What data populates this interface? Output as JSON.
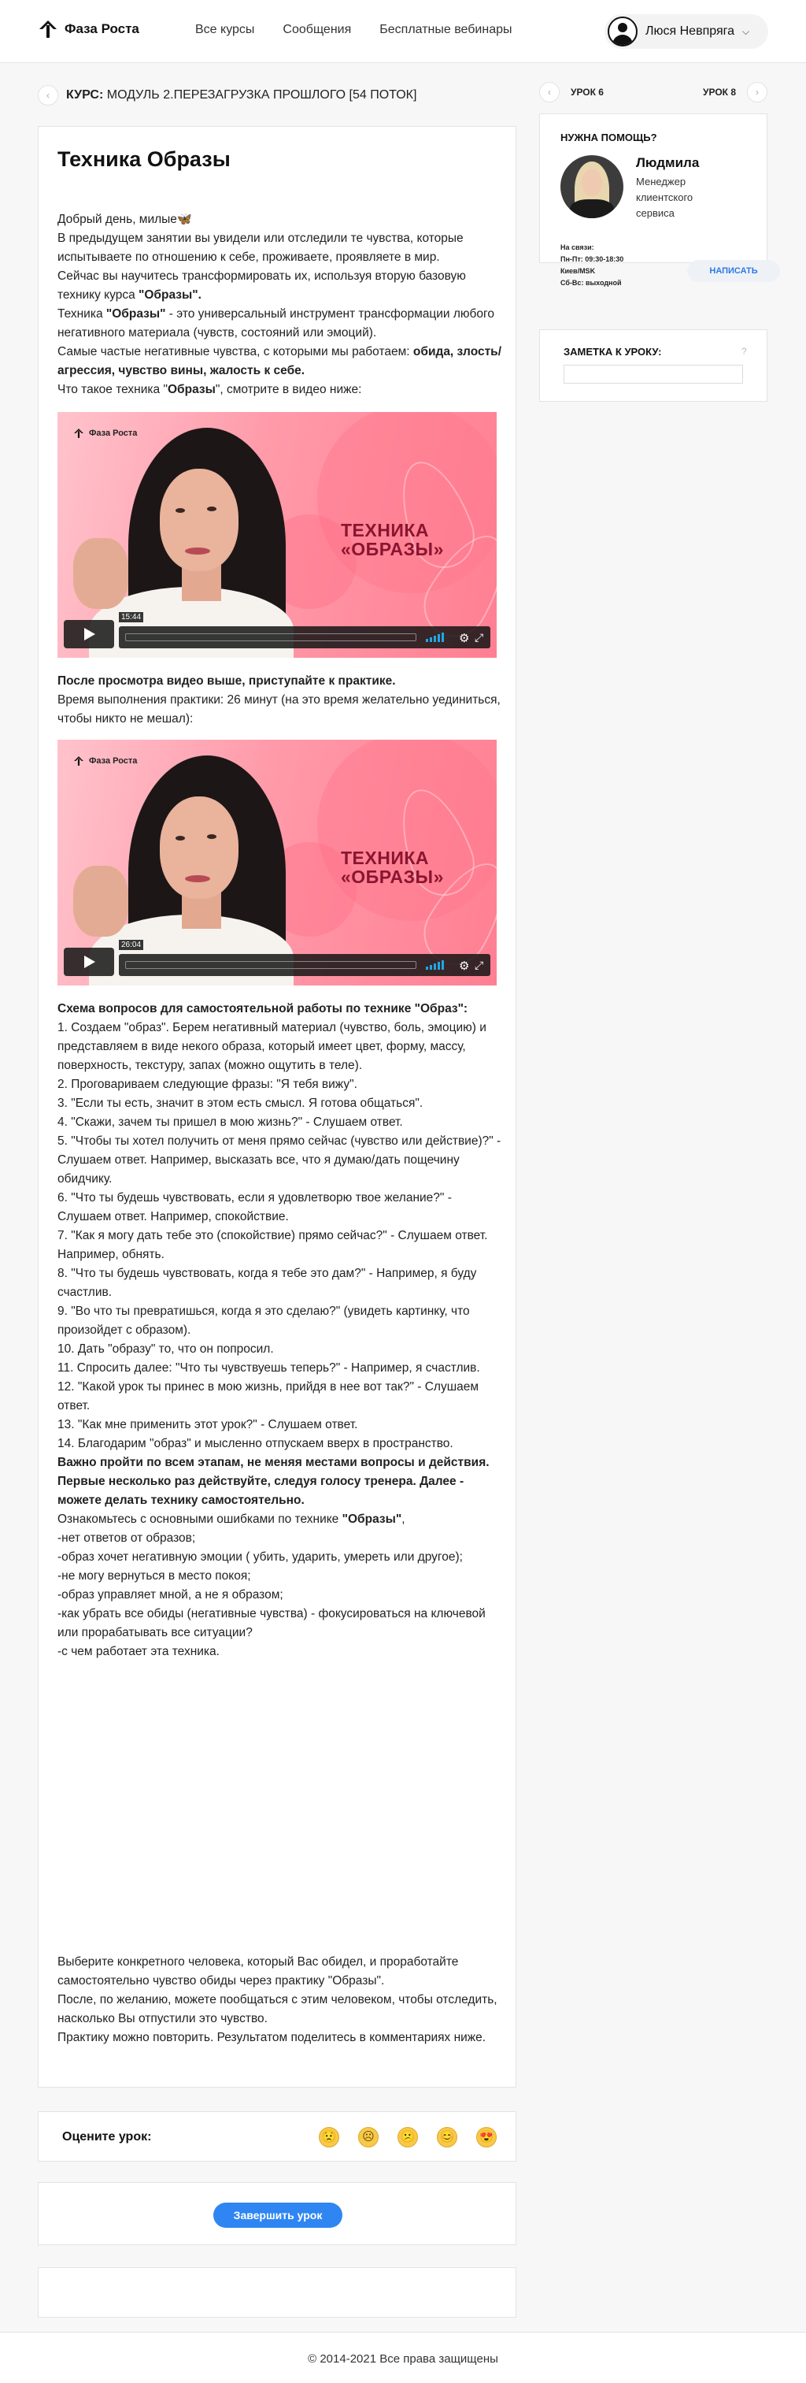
{
  "header": {
    "logo": "Фаза Роста",
    "nav": [
      "Все курсы",
      "Сообщения",
      "Бесплатные вебинары"
    ],
    "user_name": "Люся Невпряга"
  },
  "course": {
    "prefix": "КУРС:",
    "name": "МОДУЛЬ 2.ПЕРЕЗАГРУЗКА ПРОШЛОГО [54 ПОТОК]"
  },
  "lesson": {
    "title": "Техника Образы",
    "intro": [
      "Добрый день, милые🦋",
      "В предыдущем занятии вы увидели или отследили те чувства, которые испытываете по отношению к себе, проживаете, проявляете в мир.",
      "Сейчас вы научитесь трансформировать их, используя вторую базовую технику курса",
      "Техника",
      "- это универсальный инструмент трансформации любого негативного материала (чувств, состояний или эмоций).",
      "Самые частые негативные чувства, с которыми мы работаем:",
      "Что такое техника",
      ", смотрите в видео ниже:"
    ],
    "strong": {
      "obrazy_q": "\"Образы\".",
      "obrazy": "\"Образы\"",
      "feelings": "обида, злость/агрессия, чувство вины, жалость к себе.",
      "obrazy_plain": "Образы"
    },
    "video1": {
      "brand": "Фаза Роста",
      "title_l1": "ТЕХНИКА",
      "title_l2": "«ОБРАЗЫ»",
      "time": "15:44"
    },
    "after_video_bold": "После просмотра видео выше, приступайте к практике.",
    "after_video_text": "Время выполнения практики: 26 минут (на это время желательно уединиться, чтобы никто не мешал):",
    "video2": {
      "brand": "Фаза Роста",
      "title_l1": "ТЕХНИКА",
      "title_l2": "«ОБРАЗЫ»",
      "time": "26:04"
    },
    "scheme_title": "Схема вопросов для самостоятельной работы по технике \"Образ\":",
    "steps": [
      "1. Создаем \"образ\". Берем негативный материал (чувство, боль, эмоцию) и представляем в виде некого образа, который имеет цвет, форму, массу, поверхность, текстуру, запах (можно ощутить в теле).",
      "2. Проговариваем следующие фразы: \"Я тебя вижу\".",
      "3. \"Если ты есть, значит в этом есть смысл. Я готова общаться\".",
      "4. \"Скажи, зачем ты пришел в мою жизнь?\" - Слушаем ответ.",
      "5. \"Чтобы ты хотел получить от меня прямо сейчас (чувство или действие)?\" - Слушаем ответ. Например, высказать все, что я думаю/дать пощечину обидчику.",
      "6. \"Что ты будешь чувствовать, если я удовлетворю твое желание?\" - Слушаем ответ. Например, спокойствие.",
      "7. \"Как я могу дать тебе это (спокойствие) прямо сейчас?\" - Слушаем ответ. Например, обнять.",
      "8. \"Что ты будешь чувствовать, когда я тебе это дам?\" - Например, я буду счастлив.",
      "9. \"Во что ты превратишься, когда я это сделаю?\" (увидеть картинку, что произойдет с образом).",
      "10. Дать \"образу\" то, что он попросил.",
      "11. Спросить далее: \"Что ты чувствуешь теперь?\" - Например, я счастлив.",
      "12. \"Какой урок ты принес в мою жизнь, прийдя в нее вот так?\" - Слушаем ответ.",
      "13. \"Как мне применить этот урок?\" - Слушаем ответ.",
      "14. Благодарим \"образ\" и мысленно отпускаем вверх в пространство."
    ],
    "important": "Важно пройти по всем этапам, не меняя местами вопросы и действия. Первые несколько раз действуйте, следуя голосу тренера. Далее - можете делать технику самостоятельно.",
    "mistakes_intro": "Ознакомьтесь с основными ошибками по технике",
    "mistakes": [
      "-нет ответов от образов;",
      "-образ хочет негативную эмоции ( убить, ударить, умереть или другое);",
      "-не могу вернуться в место покоя;",
      "-образ управляет мной, а не я образом;",
      "-как убрать все обиды (негативные чувства) - фокусироваться на ключевой или прорабатывать все ситуации?",
      "-с чем работает эта техника."
    ],
    "final": [
      "Выберите конкретного человека, который Вас обидел, и проработайте самостоятельно чувство обиды через практику \"Образы\".",
      "После, по желанию, можете пообщаться с этим человеком, чтобы отследить, насколько Вы отпустили это чувство.",
      "Практику можно повторить. Результатом поделитесь в комментариях ниже."
    ]
  },
  "sidebar": {
    "prev_lesson": "УРОК 6",
    "next_lesson": "УРОК 8",
    "help_title": "НУЖНА ПОМОЩЬ?",
    "manager_name": "Людмила",
    "manager_role": "Менеджер клиентского сервиса",
    "contacts": [
      "На связи:",
      "Пн-Пт: 09:30-18:30",
      "Киев/MSK",
      "Сб-Вс: выходной"
    ],
    "write_button": "НАПИСАТЬ",
    "note_title": "ЗАМЕТКА К УРОКУ:",
    "note_hint": "?"
  },
  "rating": {
    "label": "Оцените урок:",
    "emojis": [
      "😟",
      "☹",
      "😕",
      "😊",
      "😍"
    ]
  },
  "finish_button": "Завершить урок",
  "footer": "© 2014-2021 Все права защищены"
}
